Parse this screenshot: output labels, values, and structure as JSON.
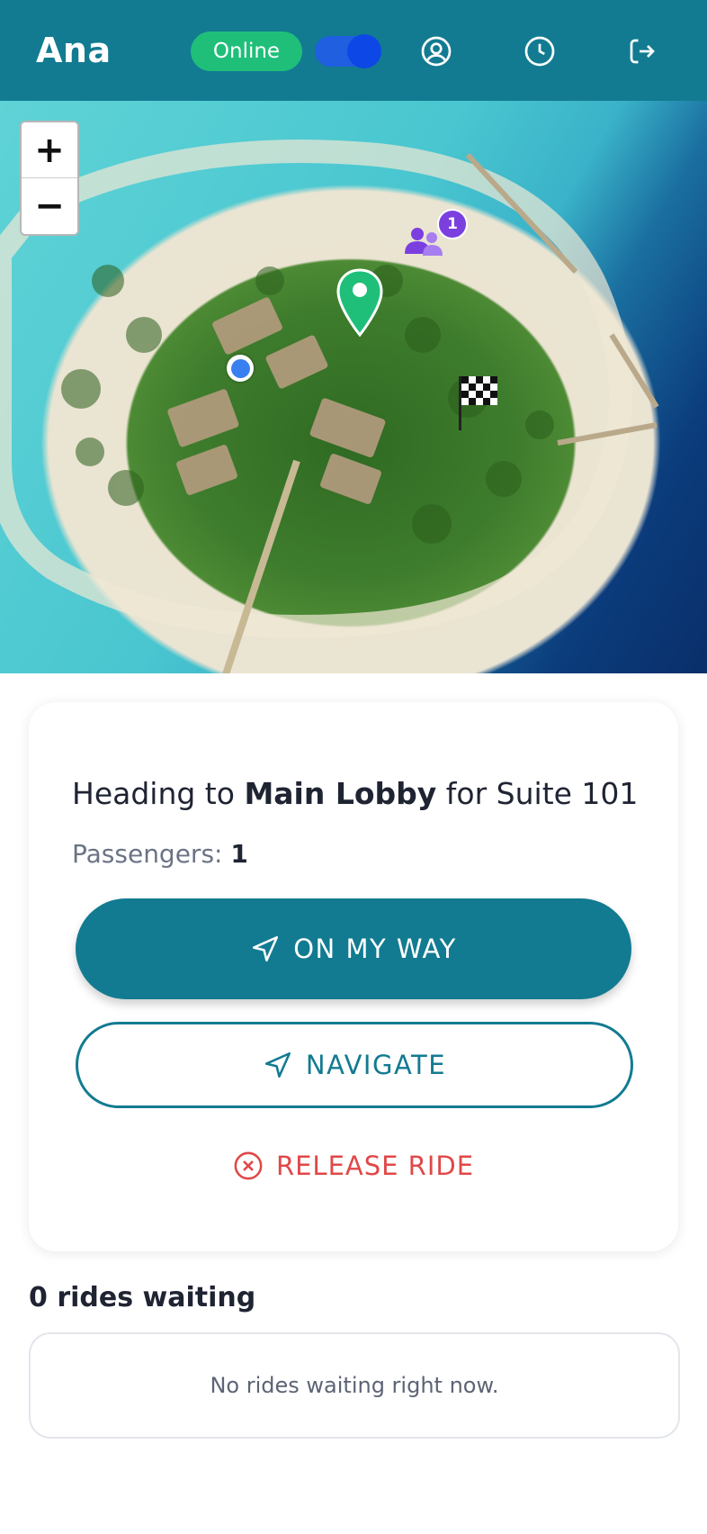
{
  "header": {
    "driver_name": "Ana",
    "status_label": "Online",
    "online_toggle_on": true,
    "icons": [
      "account-icon",
      "history-icon",
      "logout-icon"
    ],
    "bg_color": "#127b91"
  },
  "map": {
    "zoom_in_label": "+",
    "zoom_out_label": "−",
    "passenger_group_count": "1",
    "markers": [
      "pickup-pin-marker",
      "driver-location-marker",
      "destination-flag-marker",
      "passenger-group-marker"
    ]
  },
  "ride": {
    "heading_prefix": "Heading to",
    "destination": "Main Lobby",
    "heading_suffix": "for Suite 101",
    "passengers_label": "Passengers:",
    "passengers_count": "1",
    "on_my_way_label": "ON MY WAY",
    "navigate_label": "NAVIGATE",
    "release_label": "RELEASE RIDE"
  },
  "queue": {
    "title": "0 rides waiting",
    "empty_message": "No rides waiting right now."
  },
  "colors": {
    "primary": "#127b91",
    "online": "#1fbf7a",
    "danger": "#e04848",
    "passenger_marker": "#7b3fe0",
    "pickup_marker": "#1fbf7a"
  }
}
